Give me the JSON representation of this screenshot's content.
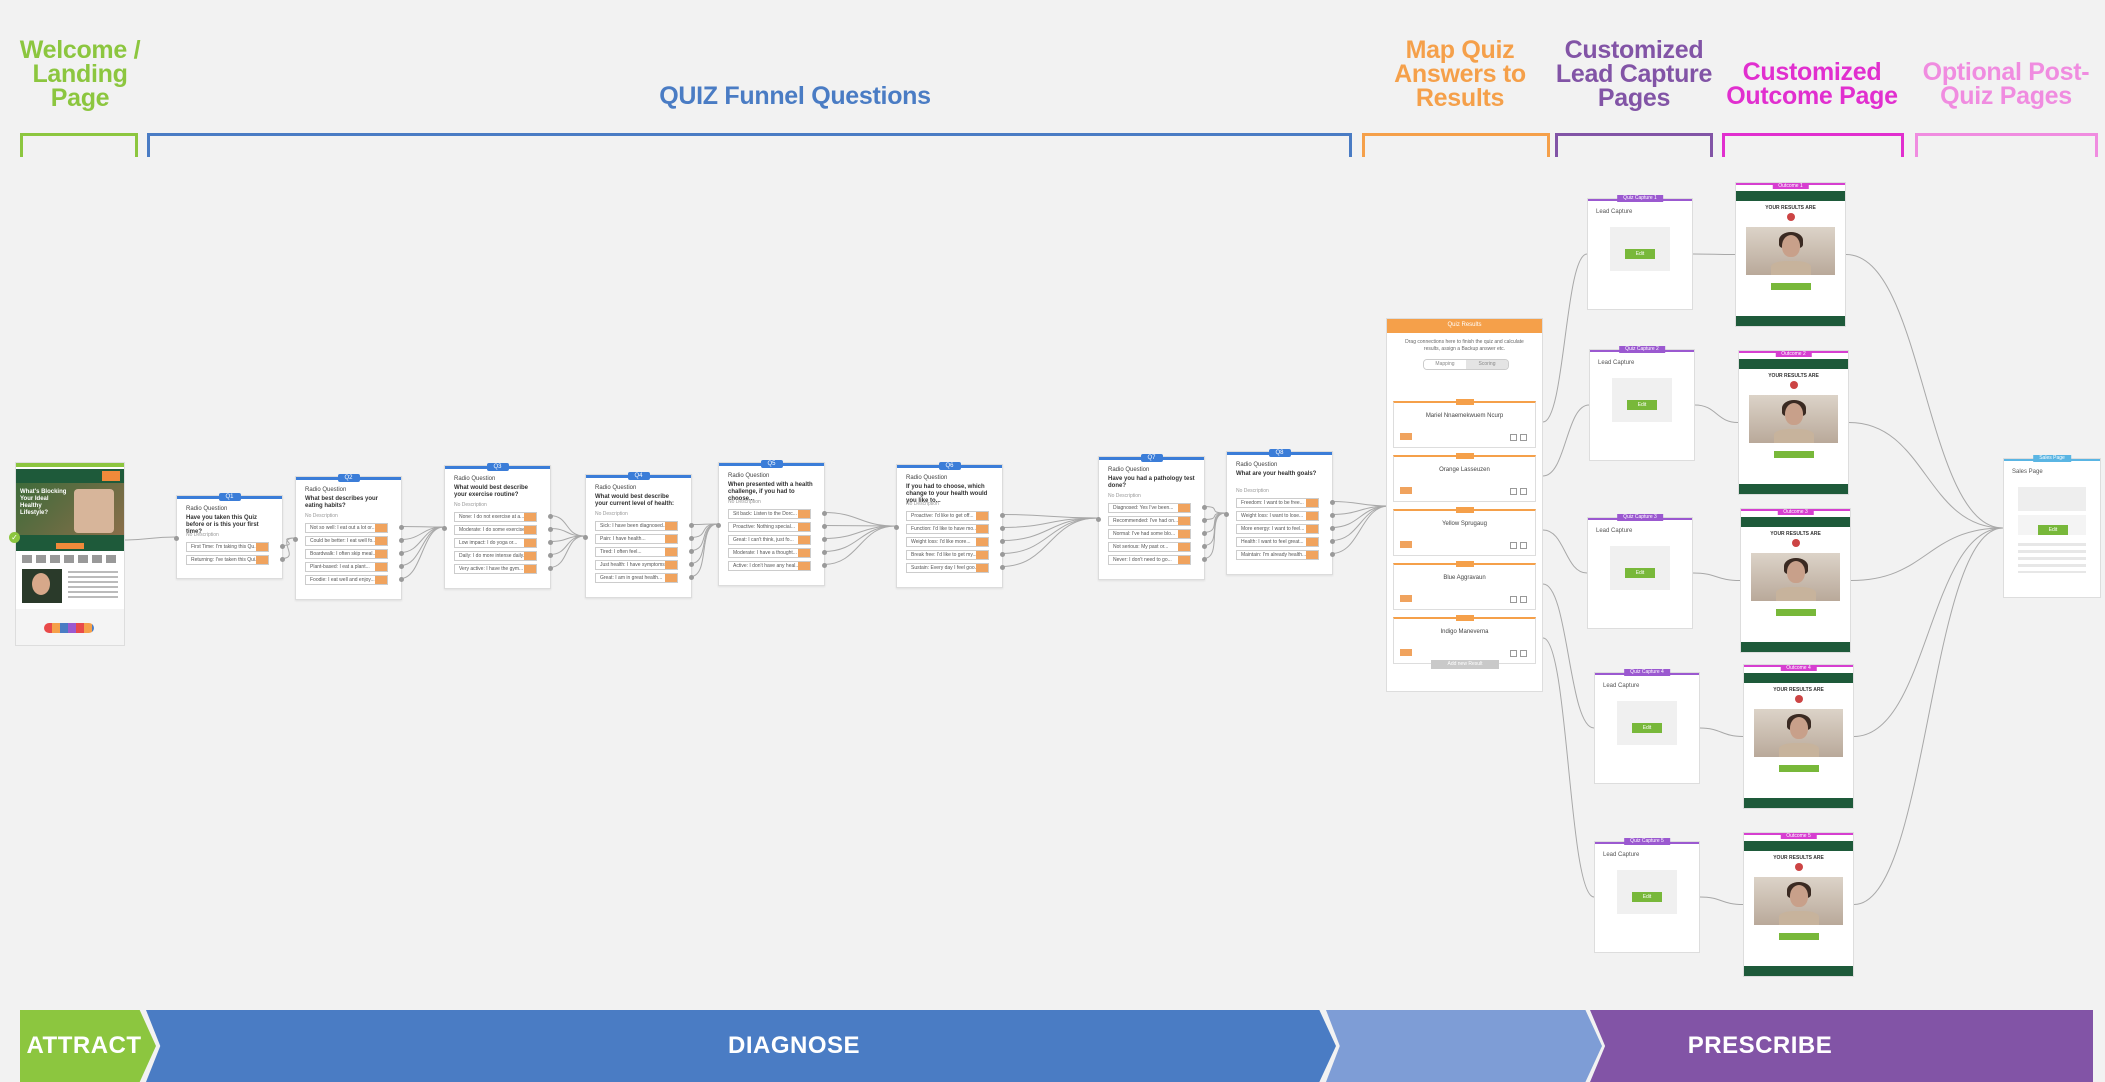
{
  "sections": {
    "welcome": {
      "title": "Welcome / Landing Page",
      "color": "#8cc63f"
    },
    "quiz": {
      "title": "QUIZ Funnel Questions",
      "color": "#4a7cc4"
    },
    "map": {
      "title": "Map Quiz Answers to Results",
      "color": "#f5a04a"
    },
    "lead": {
      "title": "Customized Lead Capture Pages",
      "color": "#8254a6"
    },
    "outcome": {
      "title": "Customized Outcome Page",
      "color": "#e12fcf"
    },
    "post": {
      "title": "Optional Post-Quiz Pages",
      "color": "#f08ce0"
    }
  },
  "questions": [
    {
      "tag": "Q1",
      "type": "Radio Question",
      "text": "Have you taken this Quiz before or is this your first time?",
      "desc": "No Description",
      "answers": [
        "First Time: I'm taking this Qu...",
        "Returning: I've taken this Qui..."
      ]
    },
    {
      "tag": "Q2",
      "type": "Radio Question",
      "text": "What best describes your eating habits?",
      "desc": "No Description",
      "answers": [
        "Not so well: I eat out a lot or...",
        "Could be better: I eat well fo...",
        "Boardwalk: I often skip meal...",
        "Plant-based: I eat a plant...",
        "Foodie: I eat well and enjoy..."
      ]
    },
    {
      "tag": "Q3",
      "type": "Radio Question",
      "text": "What would best describe your exercise routine?",
      "desc": "No Description",
      "answers": [
        "None: I do not exercise at a...",
        "Moderate: I do some exercise...",
        "Low impact: I do yoga or...",
        "Daily: I do more intense daily...",
        "Very active: I have the gym..."
      ]
    },
    {
      "tag": "Q4",
      "type": "Radio Question",
      "text": "What would best describe your current level of health:",
      "desc": "No Description",
      "answers": [
        "Sick: I have been diagnosed...",
        "Pain: I have health...",
        "Tired: I often feel...",
        "Just health: I have symptoms...",
        "Great: I am in great health..."
      ]
    },
    {
      "tag": "Q5",
      "type": "Radio Question",
      "text": "When presented with a health challenge, if you had to choose...",
      "desc": "No Description",
      "answers": [
        "Sit back: Listen to the Dorc...",
        "Proactive: Nothing special...",
        "Great: I can't think, just fo...",
        "Moderate: I have a thought...",
        "Active: I don't have any heal..."
      ]
    },
    {
      "tag": "Q6",
      "type": "Radio Question",
      "text": "If you had to choose, which change to your health would you like to...",
      "desc": "No Description",
      "answers": [
        "Proactive: I'd like to get off...",
        "Function: I'd like to have mo...",
        "Weight loss: I'd like more...",
        "Break free: I'd like to get my...",
        "Sustain: Every day I feel goo..."
      ]
    },
    {
      "tag": "Q7",
      "type": "Radio Question",
      "text": "Have you had a pathology test done?",
      "desc": "No Description",
      "answers": [
        "Diagnosed: Yes I've been...",
        "Recommended: I've had on...",
        "Normal: I've had some blo...",
        "Not serious: My past or...",
        "Never: I don't need to go..."
      ]
    },
    {
      "tag": "Q8",
      "type": "Radio Question",
      "text": "What are your health goals?",
      "desc": "No Description",
      "answers": [
        "Freedom: I want to be free...",
        "Weight loss: I want to lose...",
        "More energy: I want to feel...",
        "Health: I want to feel great...",
        "Maintain: I'm already health..."
      ]
    }
  ],
  "mapping": {
    "tag": "Quiz Results",
    "hint": "Drag connections here to finish the quiz and calculate results, assign a Backup answer etc.",
    "toggle": [
      "Mapping",
      "Scoring"
    ],
    "results": [
      "Mariel Nnaemekwuem Ncurp",
      "Orange Lasseuzen",
      "Yellow Sprugaug",
      "Blue Aggravaun",
      "Indigo Maneverna"
    ],
    "add_label": "Add new Result"
  },
  "lead_pages": [
    {
      "tag": "Quiz Capture 1",
      "title": "Lead Capture",
      "button": "Edit"
    },
    {
      "tag": "Quiz Capture 2",
      "title": "Lead Capture",
      "button": "Edit"
    },
    {
      "tag": "Quiz Capture 3",
      "title": "Lead Capture",
      "button": "Edit"
    },
    {
      "tag": "Quiz Capture 4",
      "title": "Lead Capture",
      "button": "Edit"
    },
    {
      "tag": "Quiz Capture 5",
      "title": "Lead Capture",
      "button": "Edit"
    }
  ],
  "outcome_pages": [
    {
      "tag": "Outcome 1",
      "heading": "YOUR RESULTS ARE"
    },
    {
      "tag": "Outcome 2",
      "heading": "YOUR RESULTS ARE"
    },
    {
      "tag": "Outcome 3",
      "heading": "YOUR RESULTS ARE"
    },
    {
      "tag": "Outcome 4",
      "heading": "YOUR RESULTS ARE"
    },
    {
      "tag": "Outcome 5",
      "heading": "YOUR RESULTS ARE"
    }
  ],
  "post_page": {
    "tag": "Sales Page",
    "title": "Sales Page",
    "button": "Edit"
  },
  "landing": {
    "headline": "What's Blocking Your Ideal Healthy Lifestyle?"
  },
  "stages": {
    "attract": "ATTRACT",
    "diagnose": "DIAGNOSE",
    "prescribe": "PRESCRIBE"
  }
}
